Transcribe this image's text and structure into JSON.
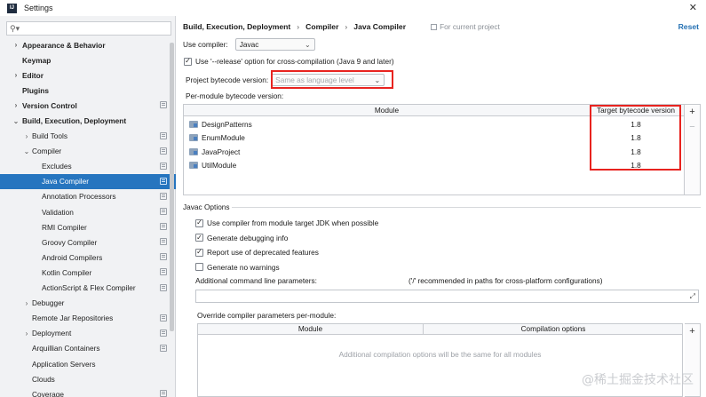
{
  "window": {
    "title": "Settings",
    "app_icon_label": "IJ"
  },
  "sidebar": {
    "search_placeholder": "",
    "items": [
      {
        "label": "Appearance & Behavior",
        "level": 0,
        "arrow": "›",
        "bold": true,
        "copy": false,
        "selected": false
      },
      {
        "label": "Keymap",
        "level": 0,
        "arrow": "",
        "bold": true,
        "copy": false,
        "selected": false
      },
      {
        "label": "Editor",
        "level": 0,
        "arrow": "›",
        "bold": true,
        "copy": false,
        "selected": false
      },
      {
        "label": "Plugins",
        "level": 0,
        "arrow": "",
        "bold": true,
        "copy": false,
        "selected": false
      },
      {
        "label": "Version Control",
        "level": 0,
        "arrow": "›",
        "bold": true,
        "copy": true,
        "selected": false
      },
      {
        "label": "Build, Execution, Deployment",
        "level": 0,
        "arrow": "⌄",
        "bold": true,
        "copy": false,
        "selected": false
      },
      {
        "label": "Build Tools",
        "level": 1,
        "arrow": "›",
        "bold": false,
        "copy": true,
        "selected": false
      },
      {
        "label": "Compiler",
        "level": 1,
        "arrow": "⌄",
        "bold": false,
        "copy": true,
        "selected": false
      },
      {
        "label": "Excludes",
        "level": 2,
        "arrow": "",
        "bold": false,
        "copy": true,
        "selected": false
      },
      {
        "label": "Java Compiler",
        "level": 2,
        "arrow": "",
        "bold": false,
        "copy": true,
        "selected": true
      },
      {
        "label": "Annotation Processors",
        "level": 2,
        "arrow": "",
        "bold": false,
        "copy": true,
        "selected": false
      },
      {
        "label": "Validation",
        "level": 2,
        "arrow": "",
        "bold": false,
        "copy": true,
        "selected": false
      },
      {
        "label": "RMI Compiler",
        "level": 2,
        "arrow": "",
        "bold": false,
        "copy": true,
        "selected": false
      },
      {
        "label": "Groovy Compiler",
        "level": 2,
        "arrow": "",
        "bold": false,
        "copy": true,
        "selected": false
      },
      {
        "label": "Android Compilers",
        "level": 2,
        "arrow": "",
        "bold": false,
        "copy": true,
        "selected": false
      },
      {
        "label": "Kotlin Compiler",
        "level": 2,
        "arrow": "",
        "bold": false,
        "copy": true,
        "selected": false
      },
      {
        "label": "ActionScript & Flex Compiler",
        "level": 2,
        "arrow": "",
        "bold": false,
        "copy": true,
        "selected": false
      },
      {
        "label": "Debugger",
        "level": 1,
        "arrow": "›",
        "bold": false,
        "copy": false,
        "selected": false
      },
      {
        "label": "Remote Jar Repositories",
        "level": 1,
        "arrow": "",
        "bold": false,
        "copy": true,
        "selected": false
      },
      {
        "label": "Deployment",
        "level": 1,
        "arrow": "›",
        "bold": false,
        "copy": true,
        "selected": false
      },
      {
        "label": "Arquillian Containers",
        "level": 1,
        "arrow": "",
        "bold": false,
        "copy": true,
        "selected": false
      },
      {
        "label": "Application Servers",
        "level": 1,
        "arrow": "",
        "bold": false,
        "copy": false,
        "selected": false
      },
      {
        "label": "Clouds",
        "level": 1,
        "arrow": "",
        "bold": false,
        "copy": false,
        "selected": false
      },
      {
        "label": "Coverage",
        "level": 1,
        "arrow": "",
        "bold": false,
        "copy": true,
        "selected": false
      }
    ]
  },
  "header": {
    "breadcrumb": [
      "Build, Execution, Deployment",
      "Compiler",
      "Java Compiler"
    ],
    "breadcrumb_separator": "›",
    "scope_note": "For current project",
    "reset_label": "Reset"
  },
  "compiler": {
    "use_compiler_label": "Use compiler:",
    "use_compiler_value": "Javac",
    "release_option_label": "Use '--release' option for cross-compilation (Java 9 and later)",
    "release_option_checked": true,
    "bytecode_label": "Project bytecode version:",
    "bytecode_placeholder": "Same as language level",
    "per_module_label": "Per-module bytecode version:"
  },
  "module_table": {
    "columns": [
      "Module",
      "Target bytecode version"
    ],
    "rows": [
      {
        "module": "DesignPatterns",
        "version": "1.8"
      },
      {
        "module": "EnumModule",
        "version": "1.8"
      },
      {
        "module": "JavaProject",
        "version": "1.8"
      },
      {
        "module": "UtilModule",
        "version": "1.8"
      }
    ],
    "add_label": "+",
    "remove_label": "−"
  },
  "javac_options": {
    "group_label": "Javac Options",
    "options": [
      {
        "label": "Use compiler from module target JDK when possible",
        "checked": true
      },
      {
        "label": "Generate debugging info",
        "checked": true
      },
      {
        "label": "Report use of deprecated features",
        "checked": true
      },
      {
        "label": "Generate no warnings",
        "checked": false
      }
    ],
    "cmdline_label": "Additional command line parameters:",
    "cmdline_hint": "('/' recommended in paths for cross-platform configurations)",
    "cmdline_value": "",
    "override_label": "Override compiler parameters per-module:",
    "override_columns": [
      "Module",
      "Compilation options"
    ],
    "override_empty": "Additional compilation options will be the same for all modules",
    "add_label": "+"
  },
  "watermark": "@稀土掘金技术社区",
  "colors": {
    "selection": "#2675bf",
    "highlight": "#e8231f",
    "link": "#2470b3"
  }
}
